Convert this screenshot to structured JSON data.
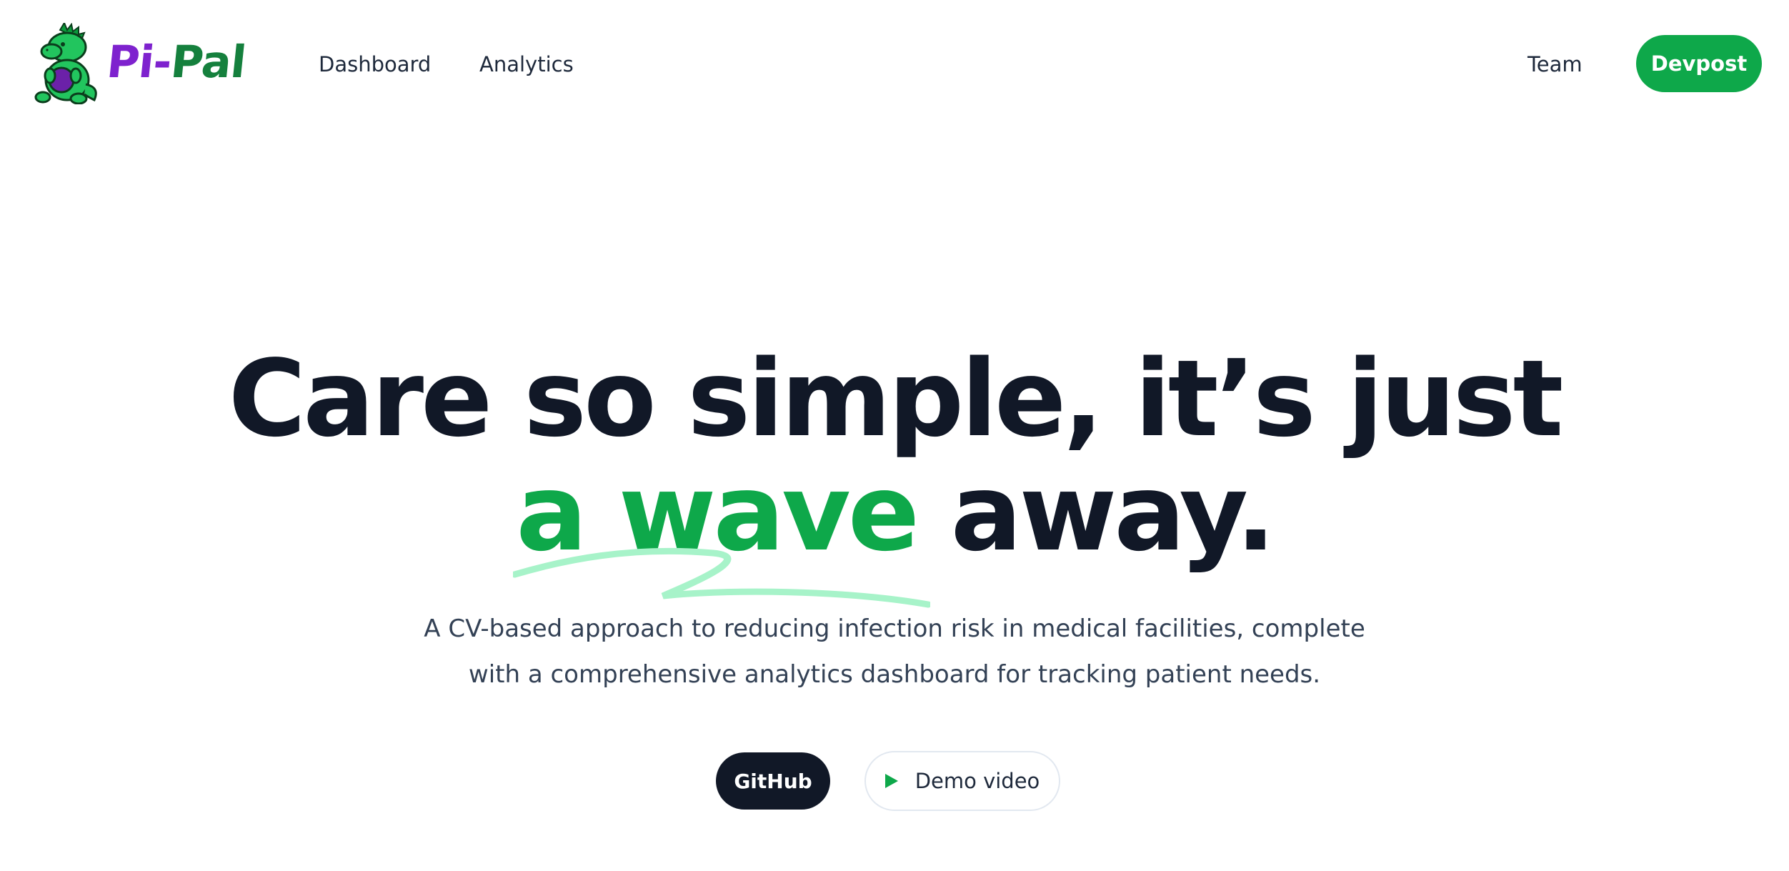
{
  "header": {
    "logo": {
      "part1": "Pi",
      "dash": "-",
      "part2": "Pal"
    },
    "nav": {
      "dashboard": "Dashboard",
      "analytics": "Analytics",
      "team": "Team"
    },
    "cta_label": "Devpost"
  },
  "hero": {
    "title_line1": "Care so simple, it’s just",
    "title_highlight": "a wave",
    "title_line2_rest": " away.",
    "subtitle_line1": "A CV-based approach to reducing infection risk in medical facilities, complete",
    "subtitle_line2": "with a comprehensive analytics dashboard for tracking patient needs.",
    "buttons": {
      "github": "GitHub",
      "demo": "Demo video"
    }
  },
  "colors": {
    "accent_green": "#0ea84a",
    "dark": "#111827",
    "logo_purple": "#7e22ce",
    "logo_green": "#15803d",
    "squiggle": "#a7f3c9"
  },
  "icons": {
    "logo": "dinosaur-mascot-icon",
    "demo": "play-icon"
  }
}
